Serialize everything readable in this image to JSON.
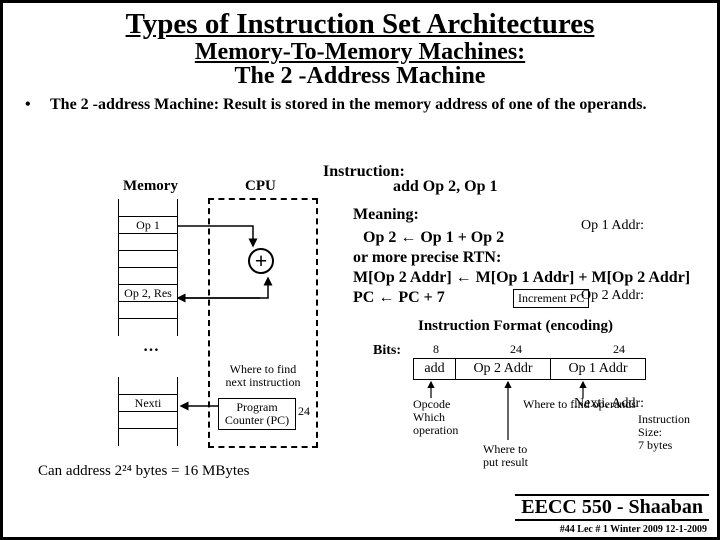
{
  "title": "Types of Instruction Set Architectures",
  "subtitle1": "Memory-To-Memory Machines:",
  "subtitle2": "The 2 -Address Machine",
  "bullet": "The 2 -address Machine: Result is stored in the memory address of one of the operands.",
  "instruction_label": "Instruction:",
  "memory_label": "Memory",
  "cpu_label": "CPU",
  "instruction_example": "add Op 2, Op 1",
  "meaning_label": "Meaning:",
  "rtn1": "Op 2  ←  Op 1 + Op 2",
  "rtn2": "or more precise RTN:",
  "rtn3": "M[Op 2 Addr] ← M[Op 1 Addr] + M[Op 2 Addr]",
  "rtn4": "PC ← PC  + 7",
  "increment_pc": "Increment PC",
  "format_heading": "Instruction Format (encoding)",
  "bits_label": "Bits:",
  "bits": {
    "op": "8",
    "a1": "24",
    "a2": "24"
  },
  "fields": {
    "op": "add",
    "a1": "Op 2 Addr",
    "a2": "Op 1 Addr"
  },
  "opcode_note": "Opcode\nWhich\noperation",
  "result_note": "Where to\nput result",
  "operands_note": "Where to find operands",
  "inst_size_note": "Instruction\nSize:\n7 bytes",
  "mem": {
    "op1_label": "Op 1 Addr:",
    "op1_val": "Op 1",
    "op2_label": "Op 2 Addr:",
    "op2_val": "Op 2, Res",
    "nexti_label": "Nexti. Addr:",
    "nexti_val": "Nexti"
  },
  "pc_label": "Program\nCounter (PC)",
  "pc_bits": "24",
  "pc_note": "Where to find\nnext instruction",
  "addr_note": "Can address 2²⁴ bytes = 16 MBytes",
  "footer": "EECC 550 - Shaaban",
  "footer_small": "#44  Lec # 1 Winter 2009 12-1-2009"
}
